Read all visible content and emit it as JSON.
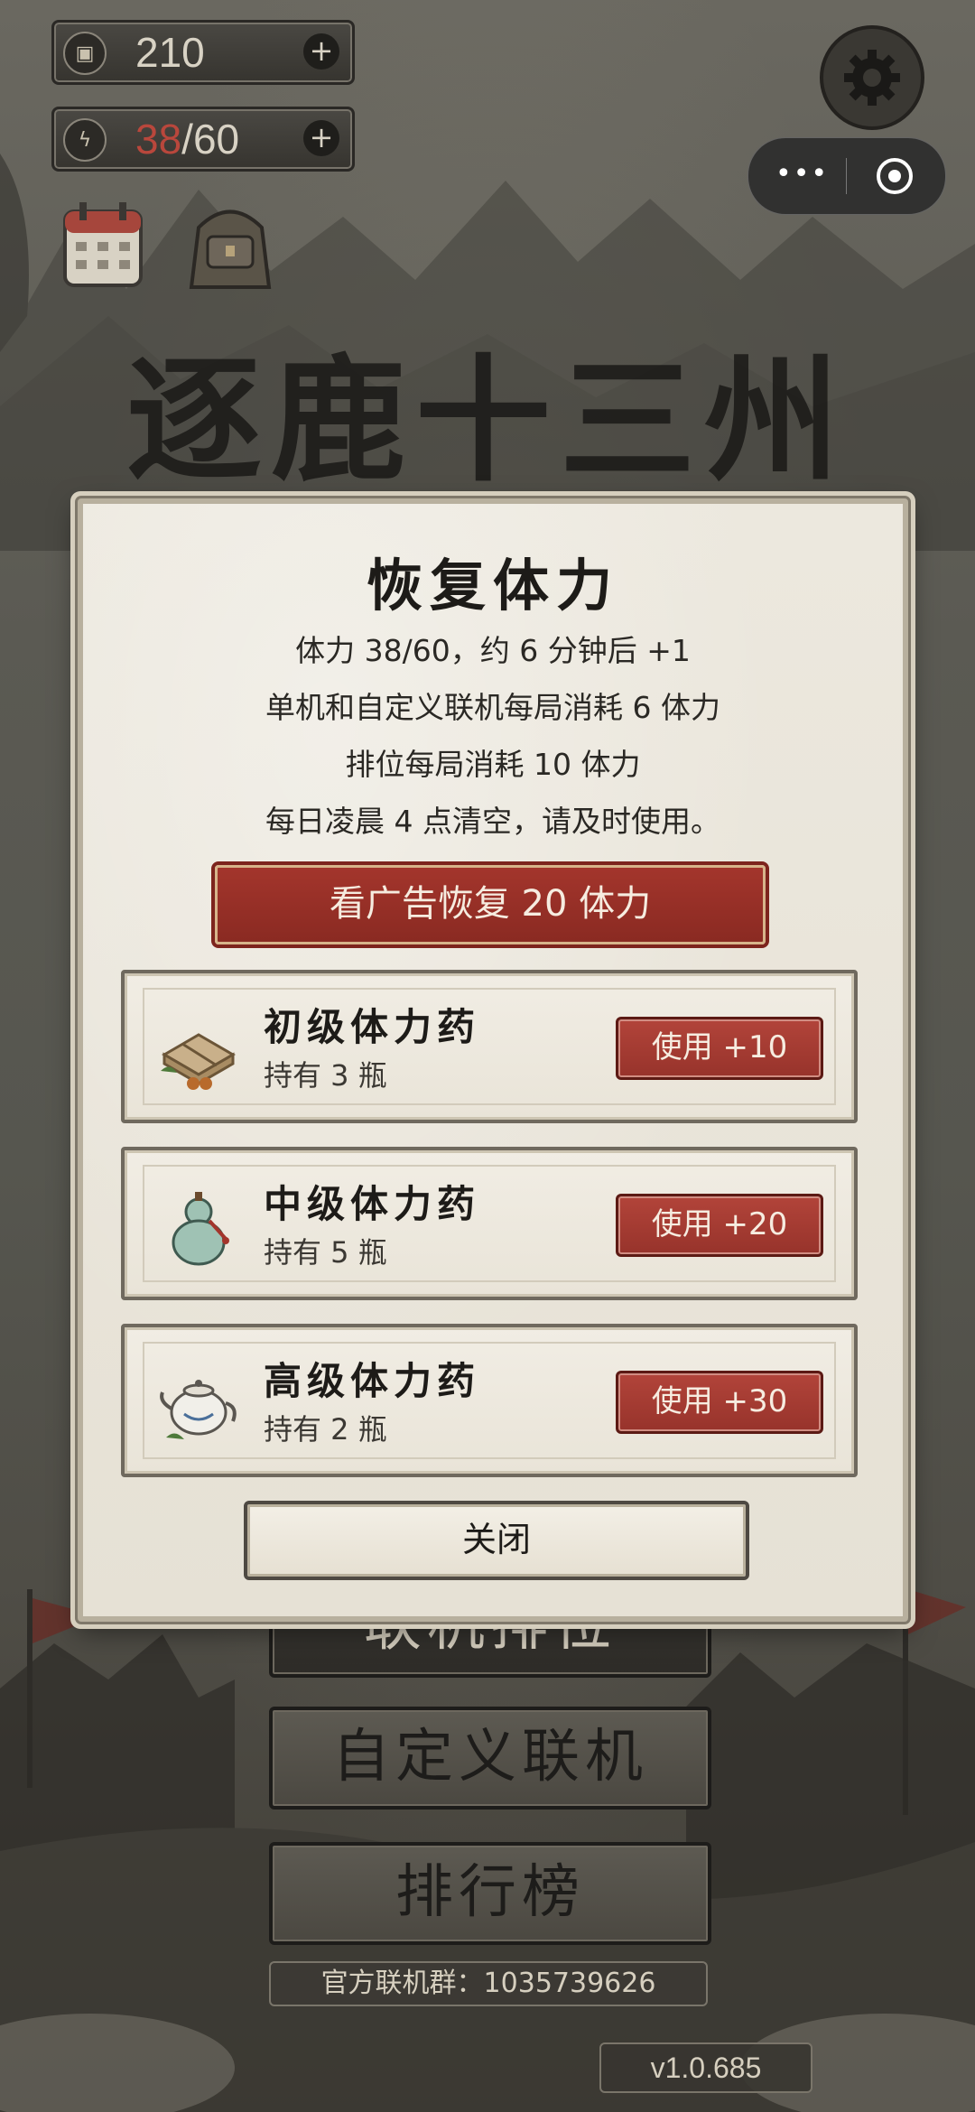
{
  "hud": {
    "coins": "210",
    "stamina_current": "38",
    "stamina_max": "/60",
    "coin_icon": "coin-icon",
    "stamina_icon": "lightning-icon"
  },
  "game_title": "逐鹿十三州",
  "background_menu": {
    "ranked_label": "联机排位",
    "custom_label": "自定义联机",
    "leaderboard_label": "排行榜",
    "official_group": "官方联机群：1035739626",
    "version": "v1.0.685"
  },
  "modal": {
    "title": "恢复体力",
    "info": [
      "体力 38/60，约 6 分钟后 +1",
      "单机和自定义联机每局消耗 6 体力",
      "排位每局消耗 10 体力",
      "每日凌晨 4 点清空，请及时使用。"
    ],
    "ad_button": "看广告恢复 20 体力",
    "items": [
      {
        "name": "初级体力药",
        "owned": "持有 3 瓶",
        "use": "使用 +10",
        "icon": "tea-bundle-icon"
      },
      {
        "name": "中级体力药",
        "owned": "持有 5 瓶",
        "use": "使用 +20",
        "icon": "gourd-icon"
      },
      {
        "name": "高级体力药",
        "owned": "持有 2 瓶",
        "use": "使用 +30",
        "icon": "teapot-icon"
      }
    ],
    "close_button": "关闭"
  },
  "colors": {
    "accent_red": "#9c352c",
    "panel_bg": "#ece8de",
    "stamina_current": "#b9473c"
  }
}
